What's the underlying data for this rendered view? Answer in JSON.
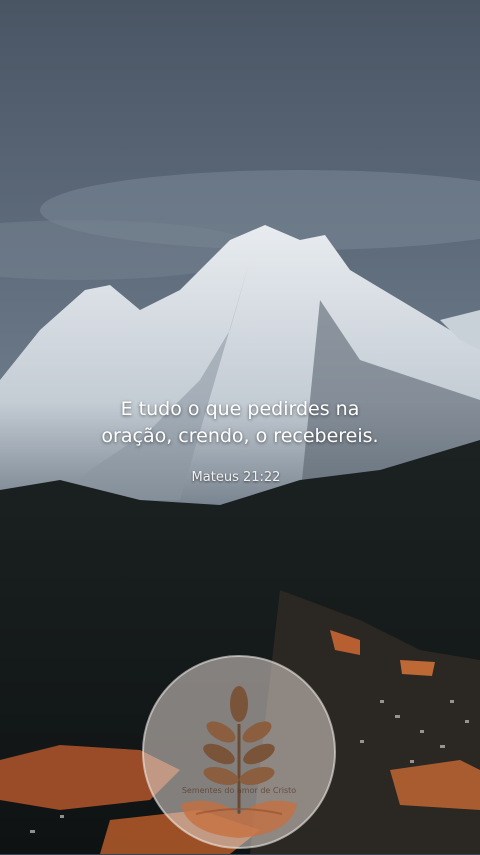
{
  "verse": {
    "line1": "E tudo o que pedirdes na",
    "line2": "oração, crendo, o recebereis.",
    "reference": "Mateus 21:22"
  },
  "logo": {
    "text": "Sementes do amor de Cristo",
    "icon": "sprout-in-hands-icon"
  }
}
